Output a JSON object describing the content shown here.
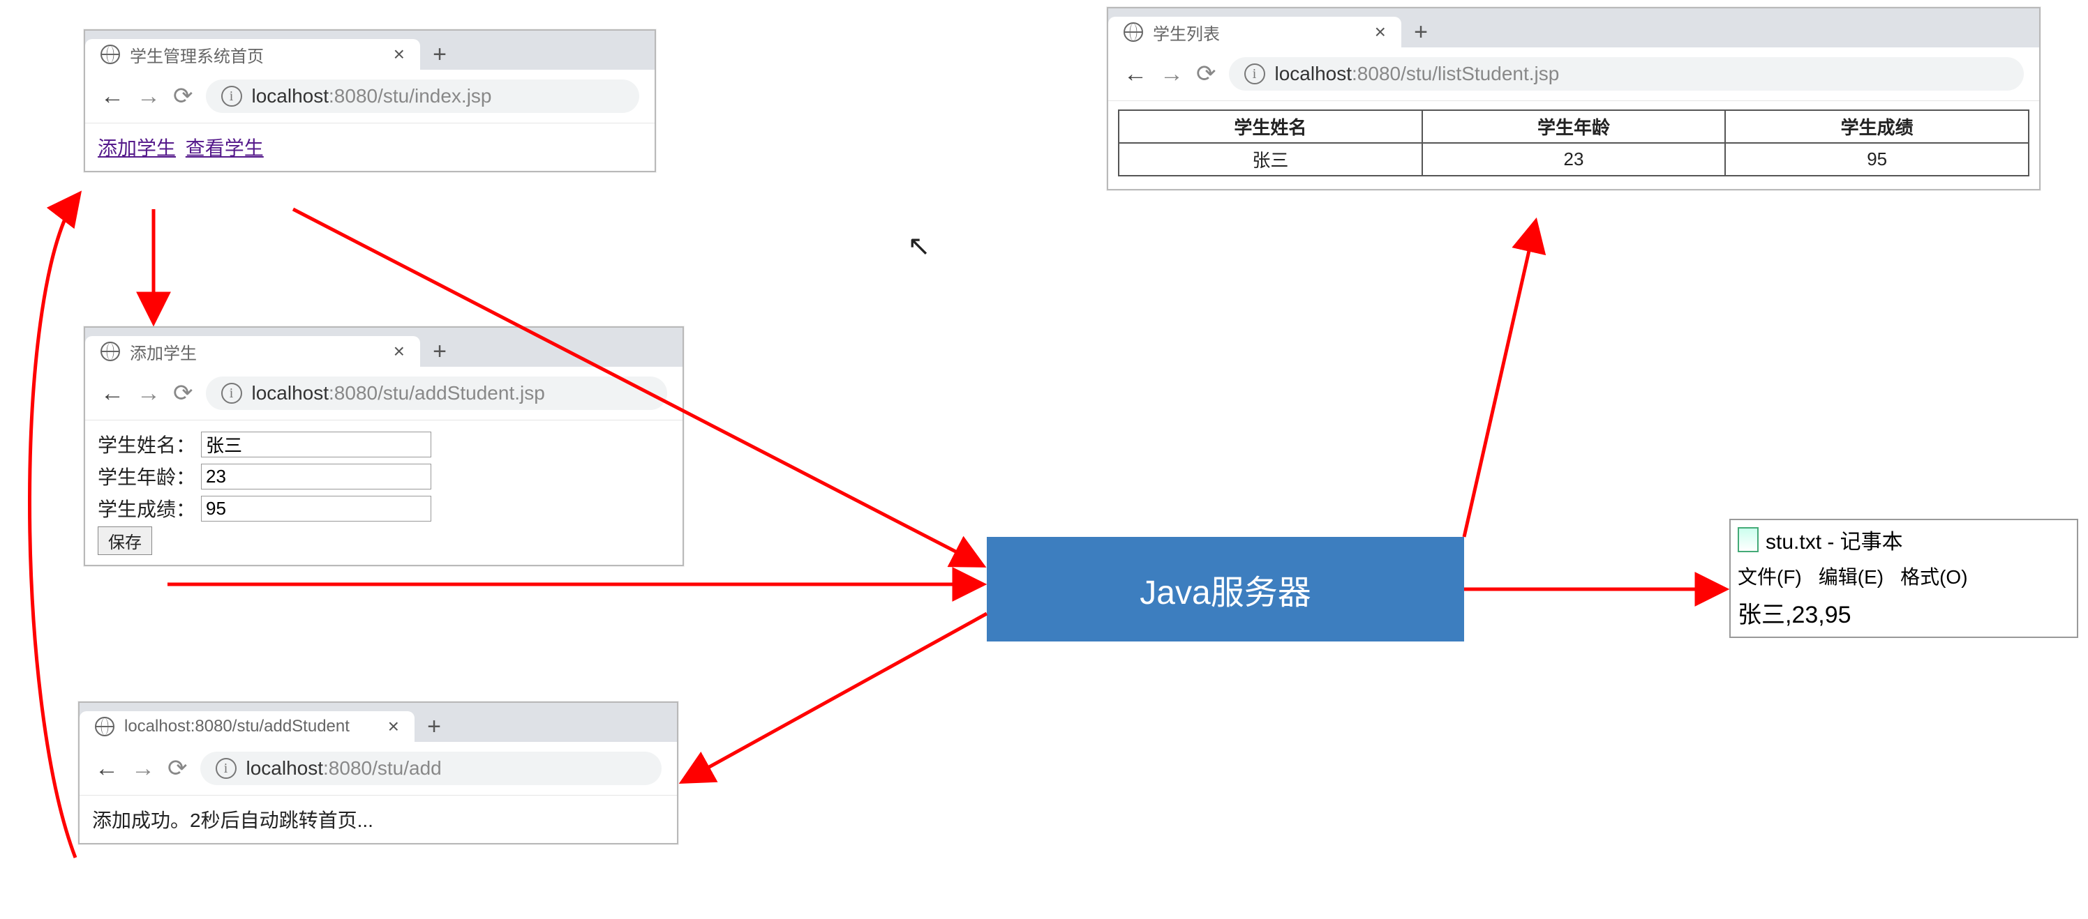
{
  "index_window": {
    "tab_title": "学生管理系统首页",
    "url_host": "localhost",
    "url_rest": ":8080/stu/index.jsp",
    "link_add": "添加学生",
    "link_view": "查看学生"
  },
  "add_window": {
    "tab_title": "添加学生",
    "url_host": "localhost",
    "url_rest": ":8080/stu/addStudent.jsp",
    "label_name": "学生姓名：",
    "label_age": "学生年龄：",
    "label_score": "学生成绩：",
    "value_name": "张三",
    "value_age": "23",
    "value_score": "95",
    "btn_save": "保存"
  },
  "result_window": {
    "tab_title": "localhost:8080/stu/addStudent",
    "url_host": "localhost",
    "url_rest": ":8080/stu/add",
    "message": "添加成功。2秒后自动跳转首页..."
  },
  "list_window": {
    "tab_title": "学生列表",
    "url_host": "localhost",
    "url_rest": ":8080/stu/listStudent.jsp",
    "col_name": "学生姓名",
    "col_age": "学生年龄",
    "col_score": "学生成绩",
    "row_name": "张三",
    "row_age": "23",
    "row_score": "95"
  },
  "server_box": {
    "label": "Java服务器"
  },
  "notepad": {
    "title": "stu.txt - 记事本",
    "menu_file": "文件(F)",
    "menu_edit": "编辑(E)",
    "menu_format": "格式(O)",
    "content": "张三,23,95"
  }
}
